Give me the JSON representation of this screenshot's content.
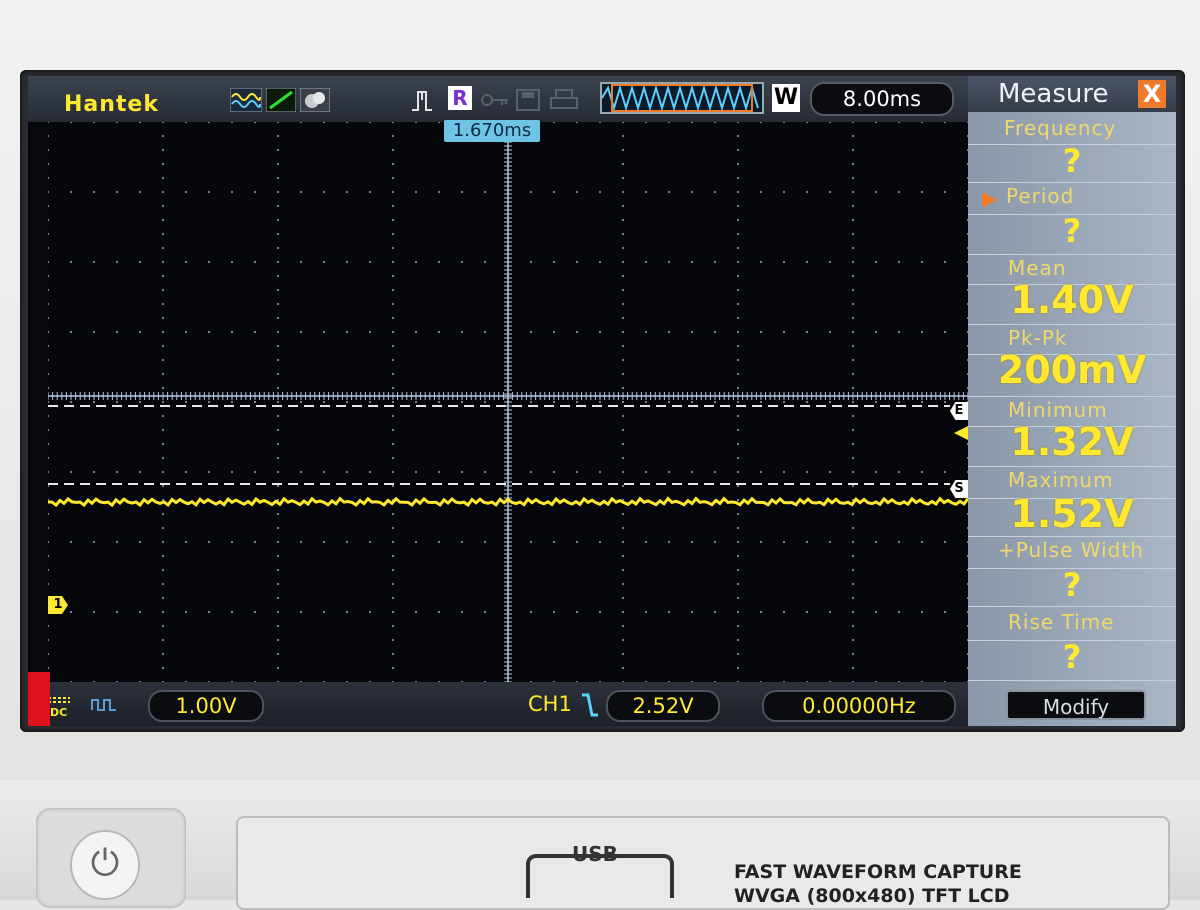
{
  "device": {
    "brand": "Hantek",
    "run_mode": "R",
    "w_badge": "W",
    "timebase": "8.00ms",
    "trigger_position": "1.670ms"
  },
  "bottom_bar": {
    "ch1_scale": "1.00V",
    "trigger_source": "CH1",
    "trigger_level": "2.52V",
    "frequency_counter": "0.00000Hz"
  },
  "markers": {
    "channel": "1",
    "e": "E",
    "s": "S"
  },
  "measure_panel": {
    "title": "Measure",
    "close": "X",
    "items": [
      {
        "label": "Frequency",
        "value": "?"
      },
      {
        "label": "Period",
        "value": "?"
      },
      {
        "label": "Mean",
        "value": "1.40V"
      },
      {
        "label": "Pk-Pk",
        "value": "200mV"
      },
      {
        "label": "Minimum",
        "value": "1.32V"
      },
      {
        "label": "Maximum",
        "value": "1.52V"
      },
      {
        "label": "+Pulse Width",
        "value": "?"
      },
      {
        "label": "Rise Time",
        "value": "?"
      }
    ],
    "modify": "Modify",
    "selected_index": 1
  },
  "front_panel": {
    "usb_label": "USB",
    "lcd_line1": "FAST WAVEFORM CAPTURE",
    "lcd_line2": "WVGA (800x480) TFT LCD"
  },
  "colors": {
    "trace": "#ffe830",
    "grid": "#7f8fa8",
    "accent": "#f07a2a",
    "trigger_tag": "#6fc4e6"
  }
}
